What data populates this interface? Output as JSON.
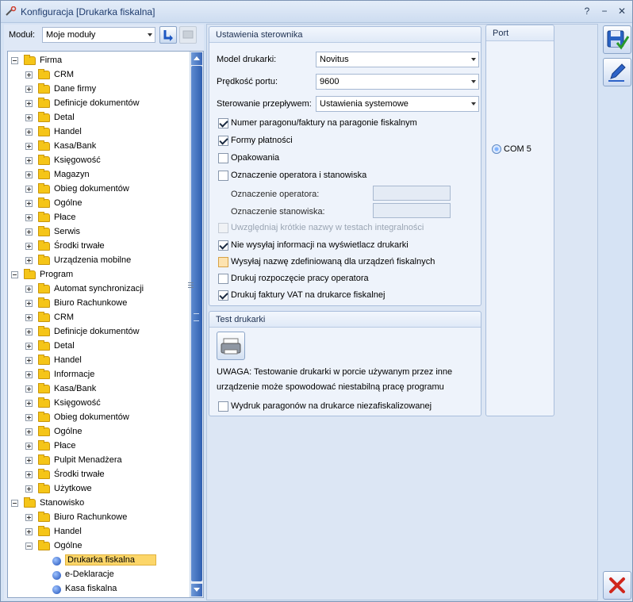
{
  "window": {
    "title": "Konfiguracja [Drukarka fiskalna]",
    "controls": {
      "help": "?",
      "minimize": "−",
      "maximize": "□",
      "close": "✕"
    }
  },
  "left": {
    "modul_label": "Moduł:",
    "modul_value": "Moje moduły",
    "tree": [
      {
        "label": "Firma",
        "level": 0,
        "type": "folder",
        "expanded": true
      },
      {
        "label": "CRM",
        "level": 1,
        "type": "folder"
      },
      {
        "label": "Dane firmy",
        "level": 1,
        "type": "folder"
      },
      {
        "label": "Definicje dokumentów",
        "level": 1,
        "type": "folder"
      },
      {
        "label": "Detal",
        "level": 1,
        "type": "folder"
      },
      {
        "label": "Handel",
        "level": 1,
        "type": "folder"
      },
      {
        "label": "Kasa/Bank",
        "level": 1,
        "type": "folder"
      },
      {
        "label": "Księgowość",
        "level": 1,
        "type": "folder"
      },
      {
        "label": "Magazyn",
        "level": 1,
        "type": "folder"
      },
      {
        "label": "Obieg dokumentów",
        "level": 1,
        "type": "folder"
      },
      {
        "label": "Ogólne",
        "level": 1,
        "type": "folder"
      },
      {
        "label": "Płace",
        "level": 1,
        "type": "folder"
      },
      {
        "label": "Serwis",
        "level": 1,
        "type": "folder"
      },
      {
        "label": "Środki trwałe",
        "level": 1,
        "type": "folder"
      },
      {
        "label": "Urządzenia mobilne",
        "level": 1,
        "type": "folder"
      },
      {
        "label": "Program",
        "level": 0,
        "type": "folder",
        "expanded": true
      },
      {
        "label": "Automat synchronizacji",
        "level": 1,
        "type": "folder"
      },
      {
        "label": "Biuro Rachunkowe",
        "level": 1,
        "type": "folder"
      },
      {
        "label": "CRM",
        "level": 1,
        "type": "folder"
      },
      {
        "label": "Definicje dokumentów",
        "level": 1,
        "type": "folder"
      },
      {
        "label": "Detal",
        "level": 1,
        "type": "folder"
      },
      {
        "label": "Handel",
        "level": 1,
        "type": "folder"
      },
      {
        "label": "Informacje",
        "level": 1,
        "type": "folder"
      },
      {
        "label": "Kasa/Bank",
        "level": 1,
        "type": "folder"
      },
      {
        "label": "Księgowość",
        "level": 1,
        "type": "folder"
      },
      {
        "label": "Obieg dokumentów",
        "level": 1,
        "type": "folder"
      },
      {
        "label": "Ogólne",
        "level": 1,
        "type": "folder"
      },
      {
        "label": "Płace",
        "level": 1,
        "type": "folder"
      },
      {
        "label": "Pulpit Menadżera",
        "level": 1,
        "type": "folder"
      },
      {
        "label": "Środki trwałe",
        "level": 1,
        "type": "folder"
      },
      {
        "label": "Użytkowe",
        "level": 1,
        "type": "folder"
      },
      {
        "label": "Stanowisko",
        "level": 0,
        "type": "folder",
        "expanded": true
      },
      {
        "label": "Biuro Rachunkowe",
        "level": 1,
        "type": "folder"
      },
      {
        "label": "Handel",
        "level": 1,
        "type": "folder"
      },
      {
        "label": "Ogólne",
        "level": 1,
        "type": "folder",
        "expanded": true
      },
      {
        "label": "Drukarka fiskalna",
        "level": 2,
        "type": "leaf",
        "selected": true
      },
      {
        "label": "e-Deklaracje",
        "level": 2,
        "type": "leaf"
      },
      {
        "label": "Kasa fiskalna",
        "level": 2,
        "type": "leaf"
      }
    ]
  },
  "sterownik": {
    "title": "Ustawienia sterownika",
    "model_label": "Model drukarki:",
    "model_value": "Novitus",
    "speed_label": "Prędkość portu:",
    "speed_value": "9600",
    "flow_label": "Sterowanie przepływem:",
    "flow_value": "Ustawienia systemowe",
    "options": [
      {
        "label": "Numer paragonu/faktury na paragonie fiskalnym",
        "checked": true
      },
      {
        "label": "Formy płatności",
        "checked": true
      },
      {
        "label": "Opakowania",
        "checked": false
      },
      {
        "label": "Oznaczenie operatora i stanowiska",
        "checked": false
      }
    ],
    "operator_label": "Oznaczenie operatora:",
    "station_label": "Oznaczenie stanowiska:",
    "options2": [
      {
        "label": "Uwzględniaj krótkie nazwy w testach integralności",
        "checked": false,
        "disabled": true
      },
      {
        "label": "Nie wysyłaj informacji na wyświetlacz drukarki",
        "checked": true
      },
      {
        "label": "Wysyłaj nazwę zdefiniowaną dla urządzeń fiskalnych",
        "checked": false,
        "hot": true
      },
      {
        "label": "Drukuj rozpoczęcie pracy operatora",
        "checked": false
      },
      {
        "label": "Drukuj faktury VAT na drukarce fiskalnej",
        "checked": true
      }
    ]
  },
  "test": {
    "title": "Test drukarki",
    "warning_line1": "UWAGA: Testowanie drukarki w porcie używanym przez inne",
    "warning_line2": "urządzenie może spowodować niestabilną pracę programu",
    "checkbox_label": "Wydruk paragonów na drukarce niezafiskalizowanej"
  },
  "port": {
    "title": "Port",
    "option": "COM 5"
  }
}
